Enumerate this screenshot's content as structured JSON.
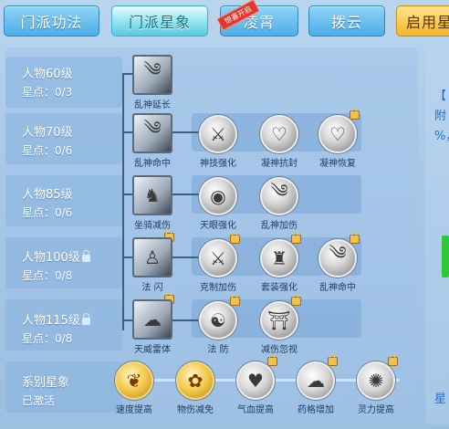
{
  "tabs": [
    {
      "label": "门派功法"
    },
    {
      "label": "门派星象"
    },
    {
      "label": "凌霄",
      "ribbon": "惊喜开启"
    },
    {
      "label": "拨云"
    },
    {
      "label": "启用星"
    }
  ],
  "rows": [
    {
      "title": "人物60级",
      "stars": "星点：0/3"
    },
    {
      "title": "人物70级",
      "stars": "星点：0/6"
    },
    {
      "title": "人物85级",
      "stars": "星点：0/6"
    },
    {
      "title": "人物100级",
      "stars": "星点：0/8"
    },
    {
      "title": "人物115级",
      "stars": "星点：0/8"
    }
  ],
  "series": {
    "title": "系别星象",
    "status": "已激活"
  },
  "nodes": {
    "r1": [
      "乱神延长"
    ],
    "r2": [
      "乱神命中",
      "神技强化",
      "凝神抗封",
      "凝神恢复"
    ],
    "r3": [
      "坐骑减伤",
      "天眼强化",
      "乱神加伤"
    ],
    "r4": [
      "法 闪",
      "克制加伤",
      "套装强化",
      "乱神命中"
    ],
    "r5": [
      "天威雷体",
      "法 防",
      "减伤忽视"
    ]
  },
  "series_nodes": [
    "速度提高",
    "物伤减免",
    "气血提高",
    "药格增加",
    "灵力提高"
  ],
  "right": {
    "line1": "【",
    "line2": "附",
    "line3": "%，",
    "line4": "星"
  }
}
